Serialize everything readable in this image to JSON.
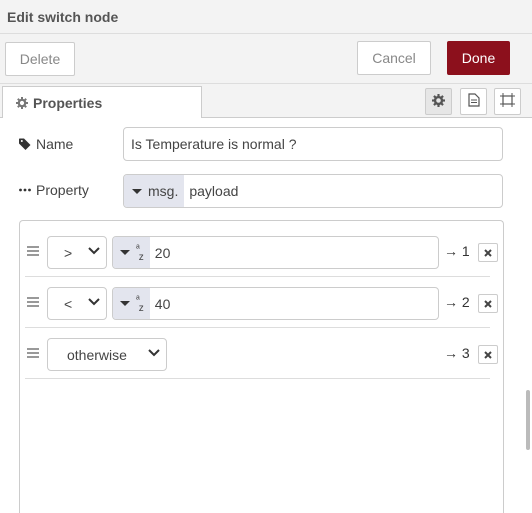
{
  "dialog": {
    "title": "Edit switch node"
  },
  "actions": {
    "delete_label": "Delete",
    "cancel_label": "Cancel",
    "done_label": "Done",
    "done_color": "#8c101c"
  },
  "tabs": [
    {
      "label": "Properties",
      "icon": "gear-icon"
    }
  ],
  "toolbar_icons": [
    "gear-icon",
    "document-icon",
    "frame-icon"
  ],
  "form": {
    "name_label": "Name",
    "name_value": "Is Temperature is normal ?",
    "property_label": "Property",
    "property_type": "msg.",
    "property_value": "payload"
  },
  "rules": [
    {
      "operator": ">",
      "type_icon": "az",
      "value": "20",
      "output": "→ 1"
    },
    {
      "operator": "<",
      "type_icon": "az",
      "value": "40",
      "output": "→ 2"
    },
    {
      "operator": "otherwise",
      "output": "→ 3"
    }
  ]
}
